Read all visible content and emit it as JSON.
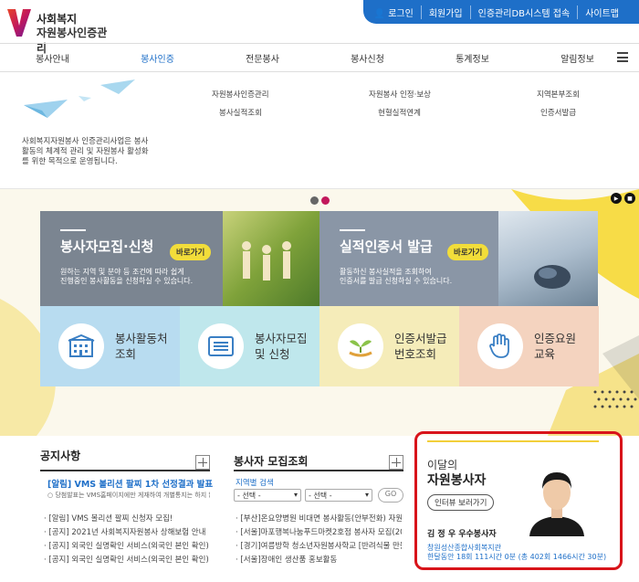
{
  "header": {
    "logo_line1": "사회복지",
    "logo_line2": "자원봉사인증관리",
    "topbar": [
      "로그인",
      "회원가입",
      "인증관리DB시스템 접속",
      "사이트맵"
    ]
  },
  "nav": [
    "봉사안내",
    "봉사인증",
    "전문봉사",
    "봉사신청",
    "통계정보",
    "알림정보"
  ],
  "dropdown": {
    "desc": "사회복지자원봉사 인증관리사업은 봉사활동의 체계적 관리 및 자원봉사 활성화를 위한 목적으로 운영됩니다.",
    "links": [
      "자원봉사인증관리",
      "봉사실적조회",
      "자원봉사 인정·보상",
      "현혈실적연계",
      "지역본부조회",
      "인증서발급"
    ]
  },
  "hero": {
    "tile1_title": "봉사자모집·신청",
    "tile1_btn": "바로가기",
    "tile1_desc1": "원하는 지역 및 분야 등 조건에 따라 쉽게",
    "tile1_desc2": "진행중인 봉사활동을 신청하실 수 있습니다.",
    "tile2_title": "실적인증서 발급",
    "tile2_btn": "바로가기",
    "tile2_desc1": "활동하신 봉사실적을 조회하여",
    "tile2_desc2": "인증서를 발급 신청하실 수 있습니다."
  },
  "quick": [
    {
      "l1": "봉사활동처",
      "l2": "조회"
    },
    {
      "l1": "봉사자모집",
      "l2": "및 신청"
    },
    {
      "l1": "인증서발급",
      "l2": "번호조회"
    },
    {
      "l1": "인증요원",
      "l2": "교육"
    }
  ],
  "notice": {
    "title": "공지사항",
    "headline": "[알림] VMS 볼리션 팔찌 1차 선정결과 발표",
    "summary": "○ 당첨발표는 VMS홈페이지에만 게재하여 개별통지는 하지 않습니다. (발",
    "items": [
      "[알림] VMS 볼리션 팔찌 신청자 모집!",
      "[공지] 2021년 사회복지자원봉사 상해보험 안내",
      "[공지] 외국인 실명확인 서비스(외국인 본인 확인) 일...",
      "[공지] 외국인 실명확인 서비스(외국인 본인 확인) 일..."
    ]
  },
  "recruit": {
    "title": "봉사자 모집조회",
    "search_label": "지역별 검색",
    "select1": "- 선택 -",
    "select2": "- 선택 -",
    "go": "GO",
    "items": [
      "[부산]온요양병원 비대면 봉사활동(안부전화) 자원...",
      "[서울]마포행복나눔푸드마켓2호점 봉사자 모집(20...",
      "[경기]여름방학 청소년자원봉사학교 [반려식물 만들...",
      "[서울]장애인 생산품 홍보활동"
    ]
  },
  "month": {
    "l1": "이달의",
    "l2": "자원봉사자",
    "btn": "인터뷰 보러가기",
    "name": "김 정 우 우수봉사자",
    "org": "창원성산종합사회복지관",
    "stats": "한달동안 18회 111시간 0분 (총 402회 1466시간 30분)"
  }
}
